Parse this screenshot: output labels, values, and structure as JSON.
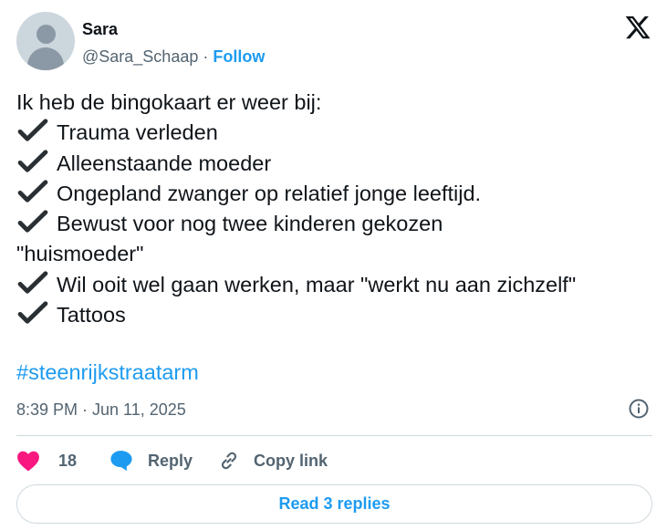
{
  "author": {
    "name": "Sara",
    "handle": "@Sara_Schaap",
    "separator": "·",
    "follow_label": "Follow"
  },
  "icons": {
    "logo": "x-logo-icon",
    "check": "heavy-check-mark-icon",
    "info": "info-icon",
    "like": "heart-icon",
    "reply": "speech-bubble-icon",
    "copy": "link-icon"
  },
  "tweet": {
    "lines": [
      {
        "check": false,
        "text": "Ik heb de bingokaart er weer bij:"
      },
      {
        "check": true,
        "text": "Trauma verleden"
      },
      {
        "check": true,
        "text": "Alleenstaande moeder"
      },
      {
        "check": true,
        "text": "Ongepland zwanger op relatief jonge leeftijd."
      },
      {
        "check": true,
        "text": "Bewust voor nog twee kinderen gekozen"
      },
      {
        "check": false,
        "text": "\"huismoeder\""
      },
      {
        "check": true,
        "text": "Wil ooit wel gaan werken, maar \"werkt nu aan zichzelf\""
      },
      {
        "check": true,
        "text": "Tattoos"
      }
    ],
    "hashtag": "#steenrijkstraatarm",
    "timestamp": "8:39 PM · Jun 11, 2025"
  },
  "actions": {
    "like_count": "18",
    "reply_label": "Reply",
    "copy_label": "Copy link"
  },
  "read_replies_label": "Read 3 replies",
  "colors": {
    "accent": "#1d9bf0",
    "like": "#f91880",
    "muted": "#536471",
    "text": "#0f1419",
    "border": "#cfd9de"
  }
}
